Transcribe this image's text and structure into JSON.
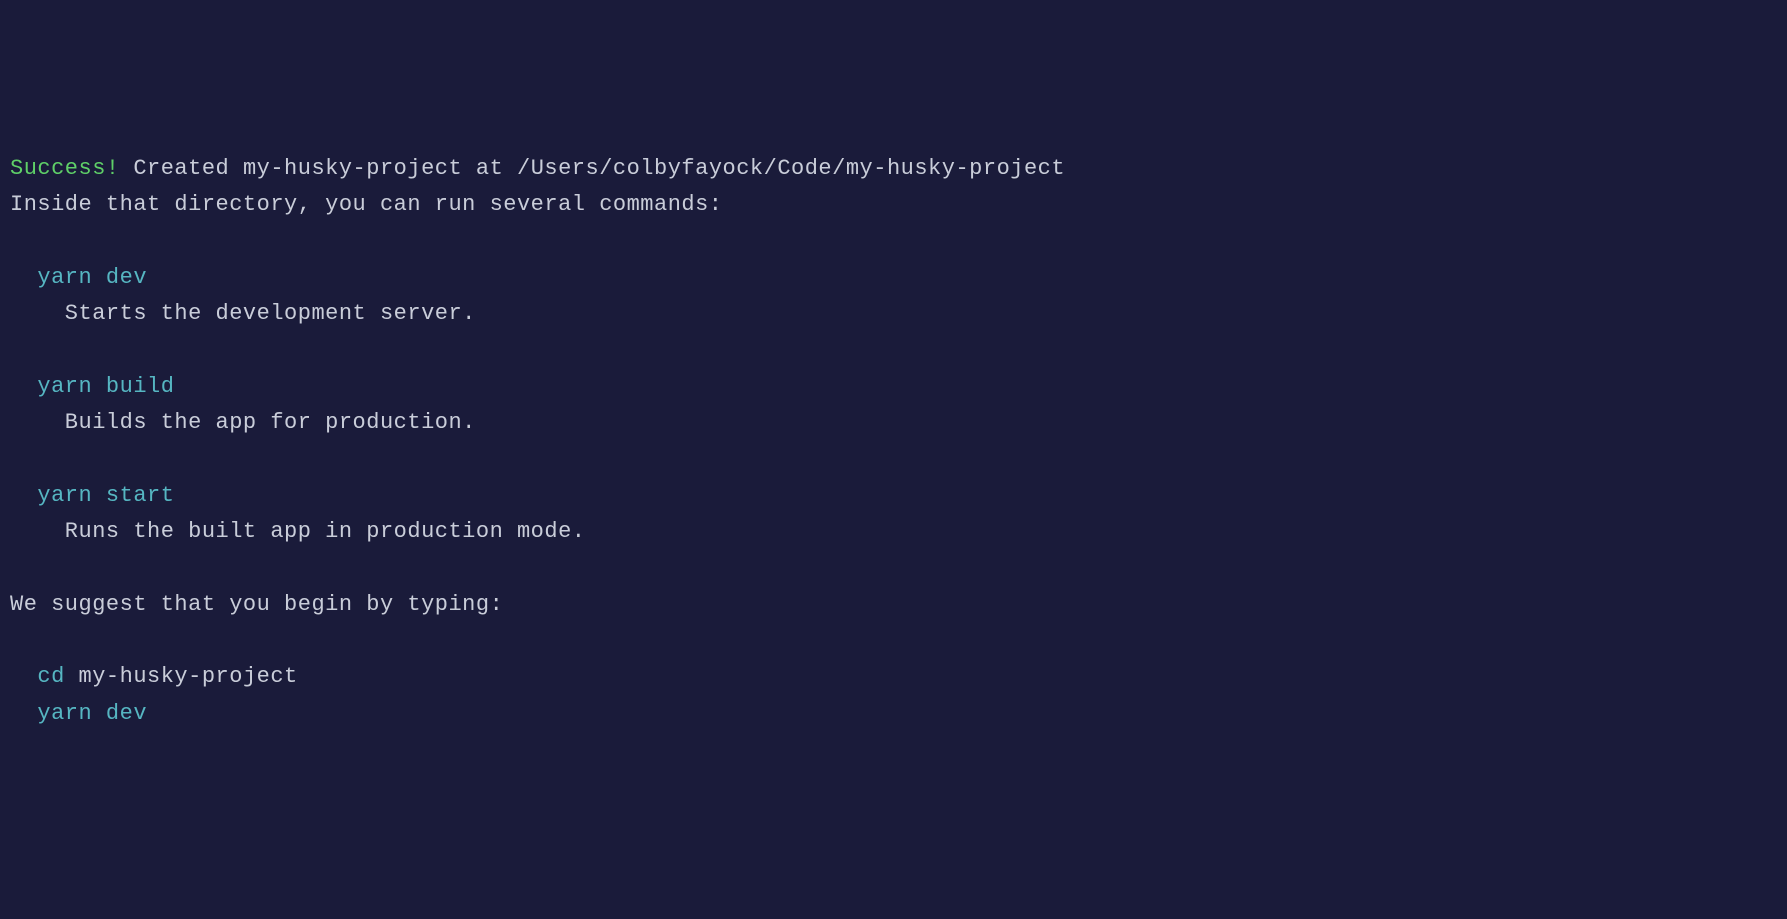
{
  "line1": {
    "success": "Success!",
    "rest": " Created my-husky-project at /Users/colbyfayock/Code/my-husky-project"
  },
  "line2": "Inside that directory, you can run several commands:",
  "commands": [
    {
      "cmd": "  yarn dev",
      "desc": "    Starts the development server."
    },
    {
      "cmd": "  yarn build",
      "desc": "    Builds the app for production."
    },
    {
      "cmd": "  yarn start",
      "desc": "    Runs the built app in production mode."
    }
  ],
  "suggest": "We suggest that you begin by typing:",
  "final": {
    "cd_cmd": "  cd",
    "cd_arg": " my-husky-project",
    "yarn_dev": "  yarn dev"
  }
}
